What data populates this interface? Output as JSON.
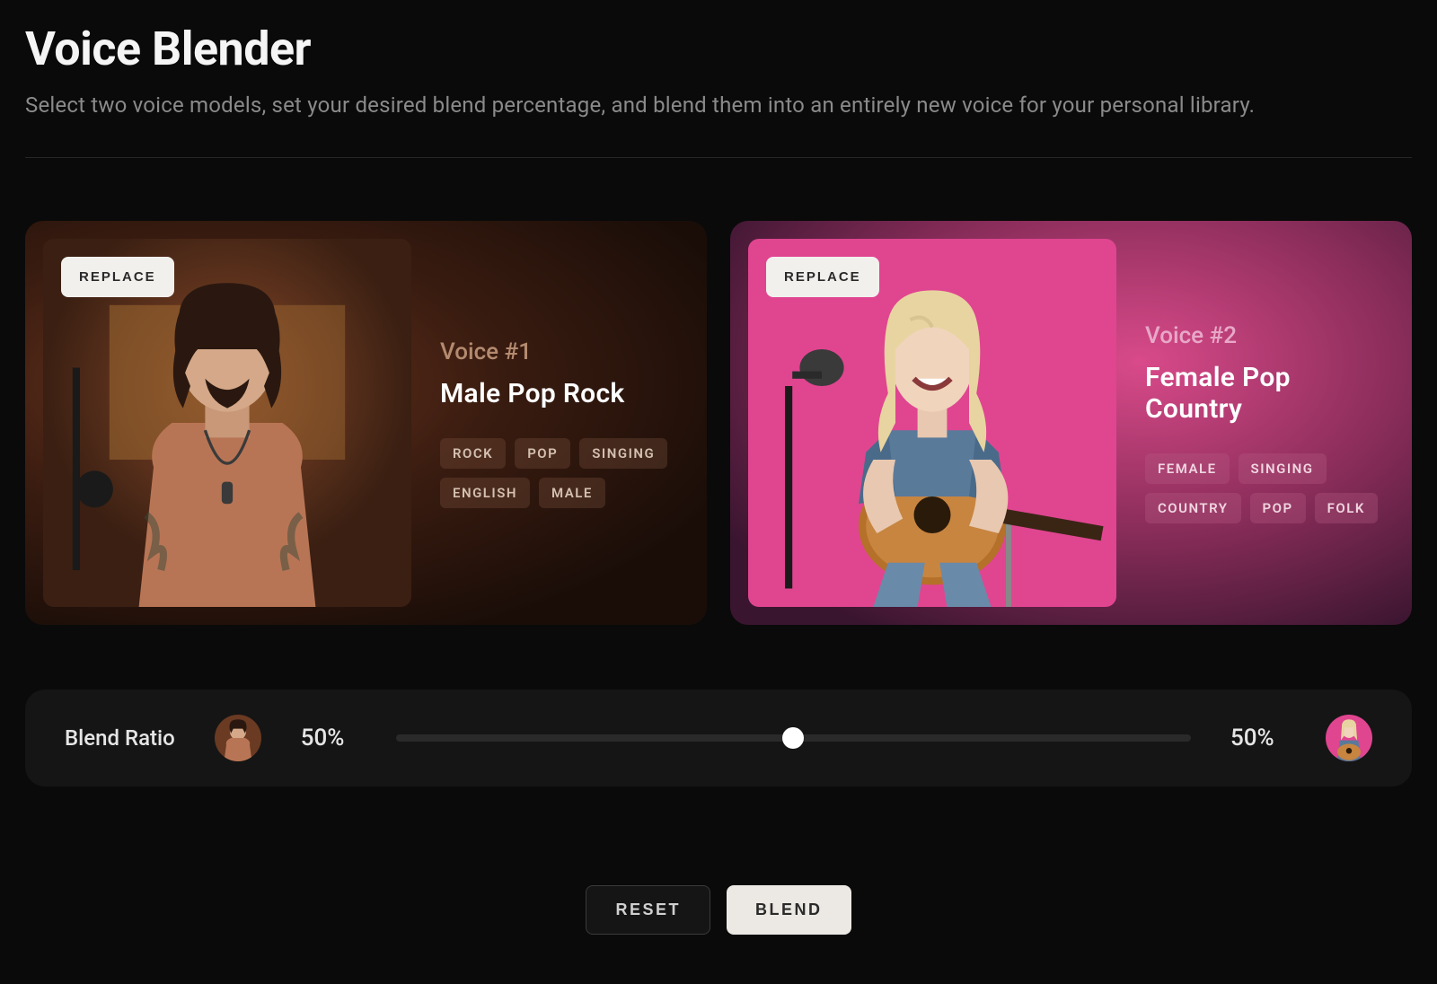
{
  "header": {
    "title": "Voice Blender",
    "subtitle": "Select two voice models, set your desired blend percentage, and blend them into an entirely new voice for your personal library."
  },
  "voices": [
    {
      "replace_label": "REPLACE",
      "label": "Voice #1",
      "name": "Male Pop Rock",
      "tags": [
        "ROCK",
        "POP",
        "SINGING",
        "ENGLISH",
        "MALE"
      ]
    },
    {
      "replace_label": "REPLACE",
      "label": "Voice #2",
      "name": "Female Pop Country",
      "tags": [
        "FEMALE",
        "SINGING",
        "COUNTRY",
        "POP",
        "FOLK"
      ]
    }
  ],
  "blend": {
    "label": "Blend Ratio",
    "left_percent": "50%",
    "right_percent": "50%",
    "slider_value": 50
  },
  "actions": {
    "reset": "RESET",
    "blend": "BLEND"
  }
}
